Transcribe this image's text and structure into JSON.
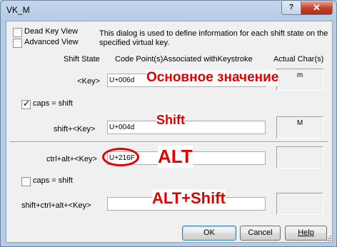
{
  "window": {
    "title": "VK_M",
    "help_glyph": "?",
    "close_glyph": "✕"
  },
  "options": {
    "dead_key_view": "Dead Key View",
    "advanced_view": "Advanced View",
    "description": "This dialog is used to define information for each shift state on the specified virtual key."
  },
  "headers": {
    "shift_state": "Shift State",
    "code_points": "Code Point(s)Associated withKeystroke",
    "actual_chars": "Actual Char(s)"
  },
  "rows": {
    "key": {
      "label": "<Key>",
      "value": "U+006d",
      "actual": "m",
      "annotation": "Основное значение"
    },
    "caps_shift_1": {
      "label": "caps = shift",
      "checked": true
    },
    "shift_key": {
      "label": "shift+<Key>",
      "value": "U+004d",
      "actual": "M",
      "annotation": "Shift"
    },
    "ctrl_alt_key": {
      "label": "ctrl+alt+<Key>",
      "value": "U+216F",
      "actual": "",
      "annotation": "ALT"
    },
    "caps_shift_2": {
      "label": "caps = shift",
      "checked": false
    },
    "shift_ctrl_alt_key": {
      "label": "shift+ctrl+alt+<Key>",
      "value": "",
      "actual": "",
      "annotation": "ALT+Shift"
    }
  },
  "buttons": {
    "ok": "OK",
    "cancel": "Cancel",
    "help": "Help"
  },
  "colors": {
    "annotation": "#e00000",
    "highlight_circle": "#e00000"
  }
}
